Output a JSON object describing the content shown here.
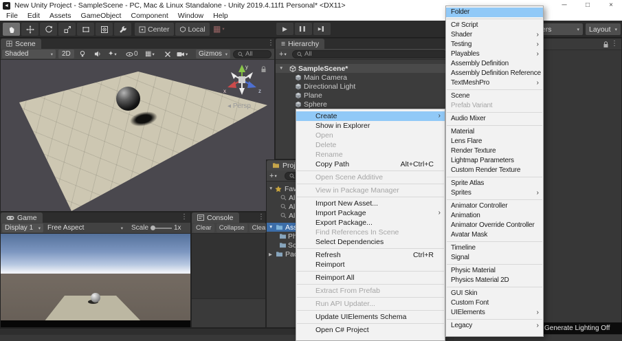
{
  "title_bar": {
    "title": "New Unity Project - SampleScene - PC, Mac & Linux Standalone - Unity 2019.4.11f1 Personal* <DX11>",
    "minimize_glyph": "─",
    "maximize_glyph": "□",
    "close_glyph": "×"
  },
  "menu_bar": {
    "items": [
      "File",
      "Edit",
      "Assets",
      "GameObject",
      "Component",
      "Window",
      "Help"
    ]
  },
  "toolbar": {
    "center_label": "Center",
    "local_label": "Local",
    "layers_label": "Layers",
    "layout_label": "Layout"
  },
  "icons": {
    "submenu_arrow": "›",
    "dropdown_arrow": "▾",
    "collapse_open": "▼",
    "collapse_closed": "▶",
    "menu_dots": "⋮",
    "hamburger": "≡",
    "plus": "+",
    "fx_star": "✦",
    "grid_glyph": "▦",
    "snap_glyph": "▦",
    "play_glyph": "▶",
    "pause_glyph": "▌▌",
    "step_glyph": "▶▌",
    "persp_arrow": "◂",
    "unity_glyph": "◄"
  },
  "scene_panel": {
    "tab": "Scene",
    "shading_mode": "Shaded",
    "toggle_2d": "2D",
    "hidden_count": "0",
    "gizmos_label": "Gizmos",
    "search_value": "All",
    "persp_label": "Persp",
    "axis": {
      "x": "x",
      "y": "y",
      "z": "z"
    }
  },
  "hierarchy_panel": {
    "tab": "Hierarchy",
    "search_value": "All",
    "scene_row": {
      "label": "SampleScene*"
    },
    "items": [
      {
        "label": "Main Camera"
      },
      {
        "label": "Directional Light"
      },
      {
        "label": "Plane"
      },
      {
        "label": "Sphere"
      }
    ]
  },
  "game_panel": {
    "tab": "Game",
    "display": "Display 1",
    "aspect": "Free Aspect",
    "scale_label": "Scale",
    "scale_value": "1x"
  },
  "console_panel": {
    "tab": "Console",
    "buttons": [
      {
        "label": "Clear"
      },
      {
        "label": "Collapse"
      },
      {
        "label": "Clear on Play"
      }
    ]
  },
  "project_panel": {
    "tab": "Project",
    "favorites_label": "Favorites",
    "favorite_items": [
      {
        "label": "All"
      },
      {
        "label": "All"
      },
      {
        "label": "All"
      }
    ],
    "assets_label": "Assets",
    "folders": [
      {
        "label": "Ph"
      },
      {
        "label": "Sc"
      }
    ],
    "packages_label": "Packages"
  },
  "status_bar": {
    "lighting_status": "Generate Lighting Off"
  },
  "context_menu": {
    "items": [
      {
        "label": "Create",
        "submenu": true,
        "highlighted": true
      },
      {
        "label": "Show in Explorer"
      },
      {
        "label": "Open",
        "disabled": true
      },
      {
        "label": "Delete",
        "disabled": true
      },
      {
        "label": "Rename",
        "disabled": true
      },
      {
        "label": "Copy Path",
        "shortcut": "Alt+Ctrl+C"
      },
      {
        "sep": true
      },
      {
        "label": "Open Scene Additive",
        "disabled": true
      },
      {
        "sep": true
      },
      {
        "label": "View in Package Manager",
        "disabled": true
      },
      {
        "sep": true
      },
      {
        "label": "Import New Asset..."
      },
      {
        "label": "Import Package",
        "submenu": true
      },
      {
        "label": "Export Package..."
      },
      {
        "label": "Find References In Scene",
        "disabled": true
      },
      {
        "label": "Select Dependencies"
      },
      {
        "sep": true
      },
      {
        "label": "Refresh",
        "shortcut": "Ctrl+R"
      },
      {
        "label": "Reimport"
      },
      {
        "sep": true
      },
      {
        "label": "Reimport All"
      },
      {
        "sep": true
      },
      {
        "label": "Extract From Prefab",
        "disabled": true
      },
      {
        "sep": true
      },
      {
        "label": "Run API Updater...",
        "disabled": true
      },
      {
        "sep": true
      },
      {
        "label": "Update UIElements Schema"
      },
      {
        "sep": true
      },
      {
        "label": "Open C# Project"
      }
    ]
  },
  "create_submenu": {
    "items": [
      {
        "label": "Folder",
        "highlighted": true
      },
      {
        "sep": true
      },
      {
        "label": "C# Script"
      },
      {
        "label": "Shader",
        "submenu": true
      },
      {
        "label": "Testing",
        "submenu": true
      },
      {
        "label": "Playables",
        "submenu": true
      },
      {
        "label": "Assembly Definition"
      },
      {
        "label": "Assembly Definition Reference"
      },
      {
        "label": "TextMeshPro",
        "submenu": true
      },
      {
        "sep": true
      },
      {
        "label": "Scene"
      },
      {
        "label": "Prefab Variant",
        "disabled": true
      },
      {
        "sep": true
      },
      {
        "label": "Audio Mixer"
      },
      {
        "sep": true
      },
      {
        "label": "Material"
      },
      {
        "label": "Lens Flare"
      },
      {
        "label": "Render Texture"
      },
      {
        "label": "Lightmap Parameters"
      },
      {
        "label": "Custom Render Texture"
      },
      {
        "sep": true
      },
      {
        "label": "Sprite Atlas"
      },
      {
        "label": "Sprites",
        "submenu": true
      },
      {
        "sep": true
      },
      {
        "label": "Animator Controller"
      },
      {
        "label": "Animation"
      },
      {
        "label": "Animator Override Controller"
      },
      {
        "label": "Avatar Mask"
      },
      {
        "sep": true
      },
      {
        "label": "Timeline"
      },
      {
        "label": "Signal"
      },
      {
        "sep": true
      },
      {
        "label": "Physic Material"
      },
      {
        "label": "Physics Material 2D"
      },
      {
        "sep": true
      },
      {
        "label": "GUI Skin"
      },
      {
        "label": "Custom Font"
      },
      {
        "label": "UIElements",
        "submenu": true
      },
      {
        "sep": true
      },
      {
        "label": "Legacy",
        "submenu": true
      }
    ]
  }
}
